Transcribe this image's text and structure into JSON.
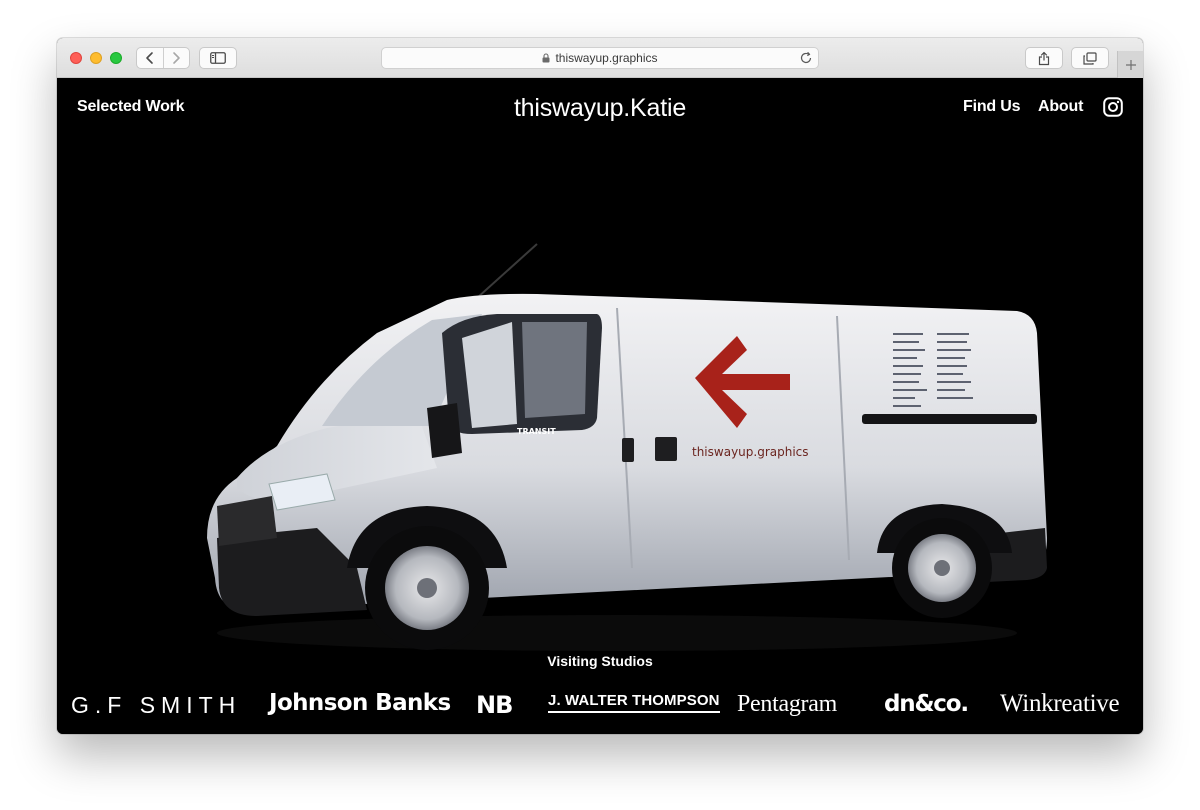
{
  "browser": {
    "url": "thiswayup.graphics"
  },
  "nav": {
    "left_link": "Selected Work",
    "site_title": "thiswayup.Katie",
    "find_us": "Find Us",
    "about": "About"
  },
  "hero": {
    "van_brand_text": "thiswayup.graphics",
    "van_badge": "TRANSIT",
    "arrow_color": "#a8221a"
  },
  "studios": {
    "heading": "Visiting Studios",
    "logos": [
      "G.F SMITH",
      "Johnson Banks",
      "NB",
      "J. WALTER THOMPSON",
      "Pentagram",
      "dn&co.",
      "Winkreative"
    ]
  },
  "colors": {
    "page_background": "#000000",
    "text": "#ffffff"
  }
}
